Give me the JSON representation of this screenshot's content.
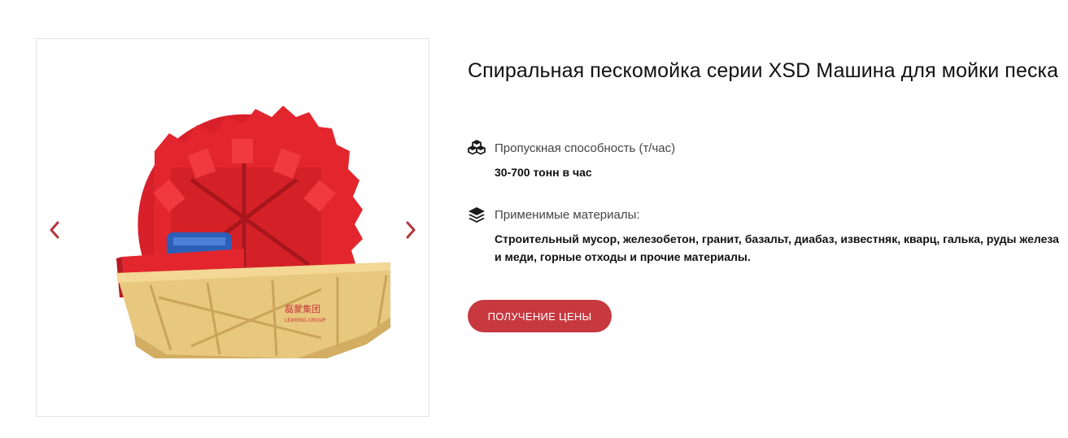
{
  "gallery": {
    "prev_icon": "chevron-left-icon",
    "next_icon": "chevron-right-icon",
    "arrow_color": "#b5343a",
    "image_logo_text": "磊蒙集团",
    "image_logo_sub": "LEIMENG GROUP"
  },
  "product": {
    "title": "Спиральная пескомойка серии XSD Машина для мойки песка",
    "specs": [
      {
        "icon": "cubes-icon",
        "label": "Пропускная способность (т/час)",
        "value": "30-700 тонн в час"
      },
      {
        "icon": "layers-icon",
        "label": "Применимые материалы:",
        "value": "Строительный мусор, железобетон, гранит, базальт, диабаз, известняк, кварц, галька, руды железа и меди, горные отходы и прочие материалы."
      }
    ],
    "cta_label": "ПОЛУЧЕНИЕ ЦЕНЫ",
    "cta_color": "#c8383f"
  }
}
